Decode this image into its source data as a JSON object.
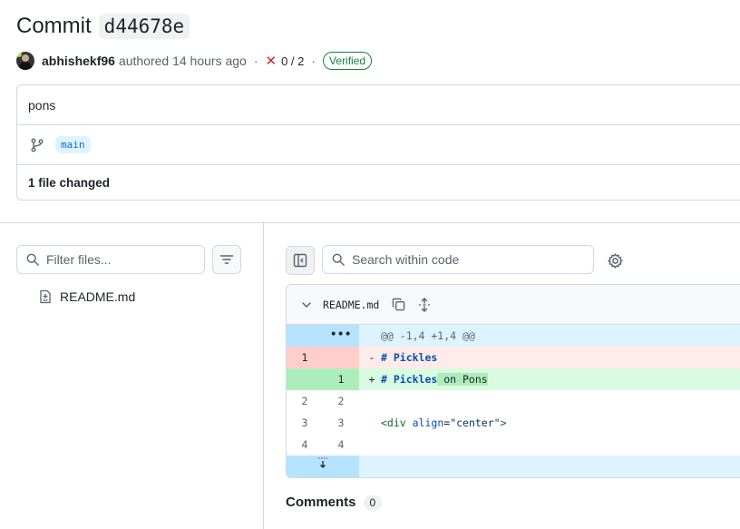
{
  "commit": {
    "title_word": "Commit",
    "sha": "d44678e",
    "author": "abhishekf96",
    "authored_text": "authored 14 hours ago",
    "separator": "·",
    "checks": "0 / 2",
    "verified": "Verified",
    "message": "pons",
    "branch": "main",
    "files_changed": "1 file changed"
  },
  "file_tree": {
    "filter_placeholder": "Filter files...",
    "files": [
      "README.md"
    ]
  },
  "code_view": {
    "search_placeholder": "Search within code",
    "file_name": "README.md",
    "expand_dots": "•••",
    "hunk_header": "@@ -1,4 +1,4 @@",
    "lines": [
      {
        "type": "del",
        "old": "1",
        "new": "",
        "sign": "-",
        "text": "# Pickles"
      },
      {
        "type": "add",
        "old": "",
        "new": "1",
        "sign": "+",
        "text_a": "# Pickles",
        "text_b": " on Pons"
      },
      {
        "type": "ctx",
        "old": "2",
        "new": "2",
        "text": ""
      },
      {
        "type": "ctx",
        "old": "3",
        "new": "3",
        "text_tag": "<div ",
        "text_attr": "align",
        "text_eq": "=",
        "text_str": "\"center\"",
        "text_end": ">"
      },
      {
        "type": "ctx",
        "old": "4",
        "new": "4",
        "text": ""
      }
    ]
  },
  "comments": {
    "label": "Comments",
    "count": "0"
  },
  "colors": {
    "accent": "#0969da",
    "verified": "#1a7f37",
    "fail": "#d1242f"
  }
}
